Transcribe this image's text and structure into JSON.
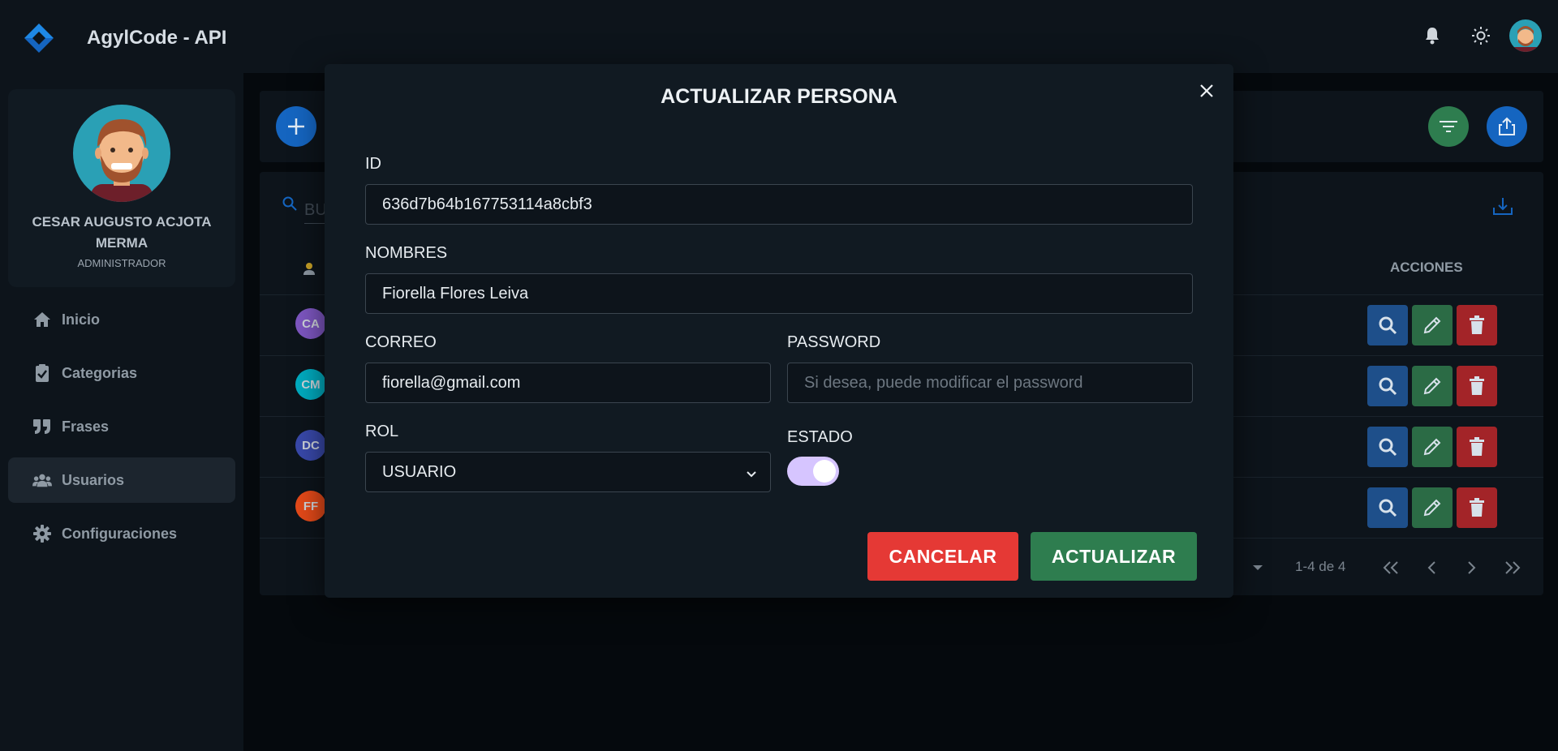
{
  "app": {
    "title": "AgylCode - API"
  },
  "colors": {
    "primary": "#1565c0",
    "success": "#2e7d4f",
    "danger": "#e53935",
    "toggle": "#d6c5ff"
  },
  "topbar": {
    "icons": [
      "bell-icon",
      "sun-icon",
      "user-avatar"
    ]
  },
  "profile": {
    "name": "CESAR AUGUSTO ACJOTA MERMA",
    "role": "ADMINISTRADOR"
  },
  "sidebar": {
    "items": [
      {
        "label": "Inicio",
        "icon": "home-icon"
      },
      {
        "label": "Categorias",
        "icon": "clipboard-check-icon"
      },
      {
        "label": "Frases",
        "icon": "quote-icon"
      },
      {
        "label": "Usuarios",
        "icon": "users-icon",
        "active": true
      },
      {
        "label": "Configuraciones",
        "icon": "gear-icon"
      }
    ]
  },
  "table": {
    "search_partial": "BU",
    "actions_header": "ACCIONES",
    "rows": [
      {
        "initials": "CA",
        "color": "#7e57c2"
      },
      {
        "initials": "CM",
        "color": "#00acc1"
      },
      {
        "initials": "DC",
        "color": "#3949ab"
      },
      {
        "initials": "FF",
        "color": "#e64a19"
      }
    ],
    "pagination": {
      "range": "1-4 de 4"
    }
  },
  "modal": {
    "title": "ACTUALIZAR PERSONA",
    "fields": {
      "id": {
        "label": "ID",
        "value": "636d7b64b167753114a8cbf3"
      },
      "nombres": {
        "label": "NOMBRES",
        "value": "Fiorella Flores Leiva"
      },
      "correo": {
        "label": "CORREO",
        "value": "fiorella@gmail.com"
      },
      "password": {
        "label": "PASSWORD",
        "placeholder": "Si desea, puede modificar el password"
      },
      "rol": {
        "label": "ROL",
        "value": "USUARIO"
      },
      "estado": {
        "label": "ESTADO",
        "value": true
      }
    },
    "cancel_label": "CANCELAR",
    "submit_label": "ACTUALIZAR"
  }
}
